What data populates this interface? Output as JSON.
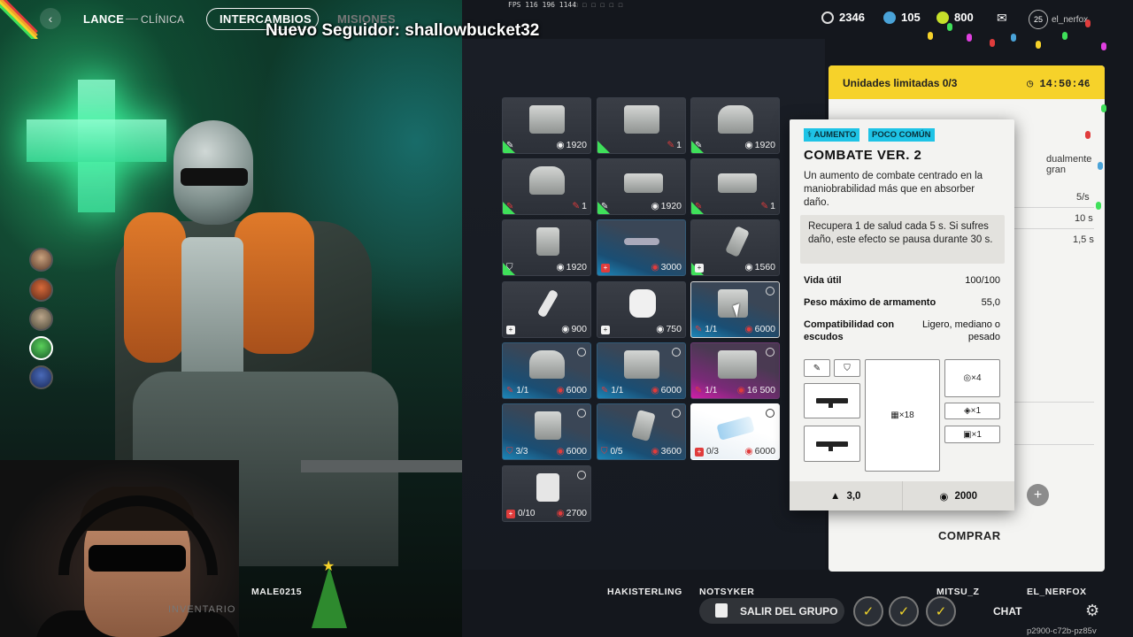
{
  "nav": {
    "back": "‹",
    "lance": "LANCE",
    "clinica": "CLÍNICA",
    "intercambios": "INTERCAMBIOS",
    "misiones": "MISIONES"
  },
  "overlay": {
    "follower": "Nuevo Seguidor: shallowbucket32",
    "fps": "FPS 116 196 1144"
  },
  "currencies": [
    {
      "icon": "coin-icon",
      "value": "2346",
      "color": "#d8d8d8"
    },
    {
      "icon": "token-icon",
      "value": "105",
      "color": "#4aa3d8"
    },
    {
      "icon": "crystal-icon",
      "value": "800",
      "color": "#c6e02a"
    }
  ],
  "user": {
    "badge": "25",
    "name": "el_nerfox"
  },
  "grid": {
    "items": [
      {
        "art": "case-icon",
        "rarity": "blue",
        "left": "✎",
        "right": "1920"
      },
      {
        "art": "case-icon",
        "rarity": "red",
        "left": "",
        "right": "1"
      },
      {
        "art": "bag-icon",
        "rarity": "blue",
        "left": "✎",
        "right": "1920"
      },
      {
        "art": "bag-icon",
        "rarity": "red",
        "left": "✎",
        "right": "1"
      },
      {
        "art": "pouch-icon",
        "rarity": "blue",
        "left": "✎",
        "right": "1920"
      },
      {
        "art": "pouch-icon",
        "rarity": "red",
        "left": "✎",
        "right": "1"
      },
      {
        "art": "grenade-icon",
        "rarity": "blue",
        "left": "⛉",
        "right": "1920"
      },
      {
        "art": "drone-icon",
        "rarity": "red",
        "left": "+",
        "right": "3000"
      },
      {
        "art": "syringe-icon",
        "rarity": "blue",
        "left": "+",
        "right": "1560"
      },
      {
        "art": "injector-icon",
        "rarity": "blue",
        "left": "+",
        "right": "900"
      },
      {
        "art": "bandage-icon",
        "rarity": "blue",
        "left": "+",
        "right": "750"
      },
      {
        "art": "augment-icon",
        "rarity": "red",
        "left": "1/1",
        "right": "6000"
      },
      {
        "art": "bag-icon",
        "rarity": "red",
        "left": "1/1",
        "right": "6000"
      },
      {
        "art": "case-icon",
        "rarity": "red",
        "left": "1/1",
        "right": "6000"
      },
      {
        "art": "turret-icon",
        "rarity": "red",
        "left": "1/1",
        "right": "16 500"
      },
      {
        "art": "backpack-icon",
        "rarity": "red",
        "left": "3/3",
        "right": "6000"
      },
      {
        "art": "shield-icon",
        "rarity": "red",
        "left": "0/5",
        "right": "3600"
      },
      {
        "art": "pack-icon",
        "rarity": "red",
        "left": "0/3",
        "right": "6000"
      },
      {
        "art": "wrap-icon",
        "rarity": "red",
        "left": "0/10",
        "right": "2700"
      }
    ]
  },
  "shop": {
    "limited": "Unidades limitadas 0/3",
    "timer": "14:50:46",
    "partial_text": "dualmente gran",
    "rows": [
      "5/s",
      "10 s",
      "1,5 s"
    ],
    "buy": "COMPRAR",
    "add": "+"
  },
  "card": {
    "tags": [
      "AUMENTO",
      "POCO COMÚN"
    ],
    "title": "COMBATE VER. 2",
    "description": "Un aumento de combate centrado en la maniobrabilidad más que en absorber daño.",
    "effect": "Recupera 1 de salud cada 5 s. Si sufres daño, este efecto se pausa durante 30 s.",
    "stats": [
      {
        "label": "Vida útil",
        "value": "100/100"
      },
      {
        "label": "Peso máximo de armamento",
        "value": "55,0"
      },
      {
        "label": "Compatibilidad con escudos",
        "value": "Ligero, mediano o pesado"
      }
    ],
    "slots": {
      "ammo": "×18",
      "grenade": "×4",
      "tool": "×1",
      "kit": "×1"
    },
    "weight": "3,0",
    "price": "2000"
  },
  "bottom": {
    "players": [
      "MALE0215",
      "HAKISTERLING",
      "NOTSYKER",
      "MITSU_Z",
      "EL_NERFOX"
    ],
    "leave": "SALIR DEL GRUPO",
    "chat": "CHAT",
    "code": "p2900-c72b-pz85v",
    "inventory": "INVENTARIO"
  }
}
